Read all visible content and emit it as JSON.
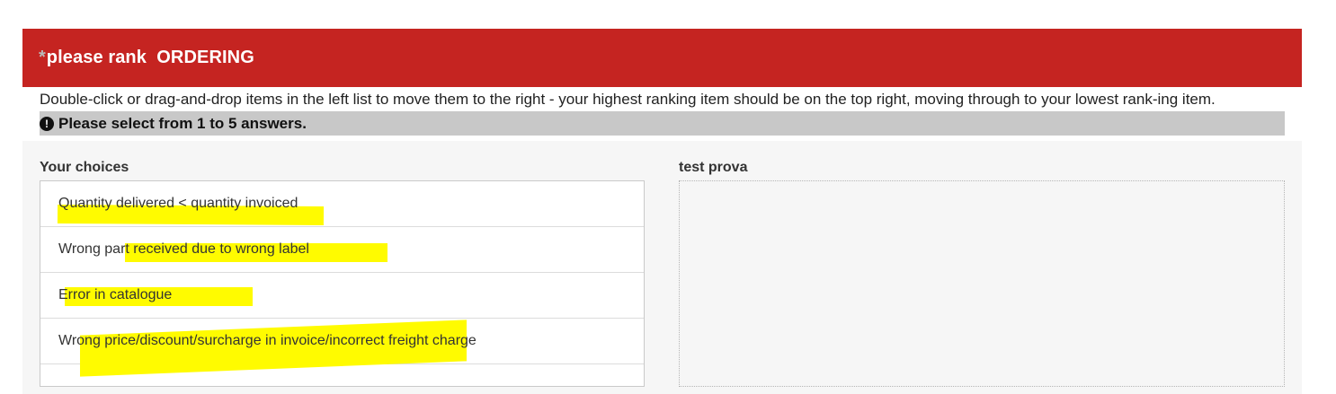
{
  "question": {
    "mandatory_mark": "*",
    "title": "please rank  ORDERING",
    "help_text": "Double-click or drag-and-drop items in the left list to move them to the right - your highest ranking item should be on the top right, moving through to your lowest rank-ing item.",
    "tip_icon": "exclamation-circle-icon",
    "tip_text": "Please select from 1 to 5 answers."
  },
  "ranking": {
    "choices_label": "Your choices",
    "rank_label": "test prova",
    "choices": [
      {
        "label": "Quantity delivered < quantity invoiced"
      },
      {
        "label": "Wrong part received due to wrong label"
      },
      {
        "label": "Error in catalogue"
      },
      {
        "label": "Wrong price/discount/surcharge in invoice/incorrect freight charge"
      }
    ]
  },
  "colors": {
    "header_bg": "#c52421",
    "tip_bg": "#c8c8c8",
    "highlight": "#fffb00"
  }
}
